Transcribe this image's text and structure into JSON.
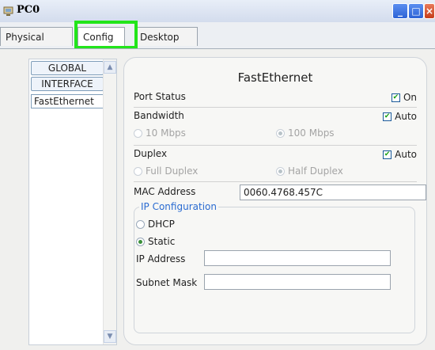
{
  "window": {
    "title": "PC0",
    "controls": {
      "minimize_icon": "minimize-icon",
      "maximize_icon": "maximize-icon",
      "close_icon": "close-icon"
    }
  },
  "tabs": [
    {
      "label": "Physical"
    },
    {
      "label": "Config",
      "selected": true
    },
    {
      "label": "Desktop"
    }
  ],
  "sidebar": {
    "items": [
      {
        "label": "GLOBAL"
      },
      {
        "label": "INTERFACE"
      },
      {
        "label": "FastEthernet",
        "selected": true
      }
    ]
  },
  "panel": {
    "title": "FastEthernet",
    "port_status": {
      "label": "Port Status",
      "checkbox_label": "On",
      "checked": true
    },
    "bandwidth": {
      "label": "Bandwidth",
      "checkbox_label": "Auto",
      "checked": true,
      "option_a": "10 Mbps",
      "option_b": "100 Mbps",
      "selected": "100 Mbps"
    },
    "duplex": {
      "label": "Duplex",
      "checkbox_label": "Auto",
      "checked": true,
      "option_a": "Full Duplex",
      "option_b": "Half Duplex",
      "selected": "Half Duplex"
    },
    "mac": {
      "label": "MAC Address",
      "value": "0060.4768.457C"
    },
    "ip_config": {
      "legend": "IP Configuration",
      "dhcp_label": "DHCP",
      "static_label": "Static",
      "selected": "Static",
      "ip_label": "IP Address",
      "ip_value": "",
      "mask_label": "Subnet Mask",
      "mask_value": ""
    }
  },
  "colors": {
    "highlight": "#22e51a",
    "legend_text": "#2a6bd1"
  }
}
